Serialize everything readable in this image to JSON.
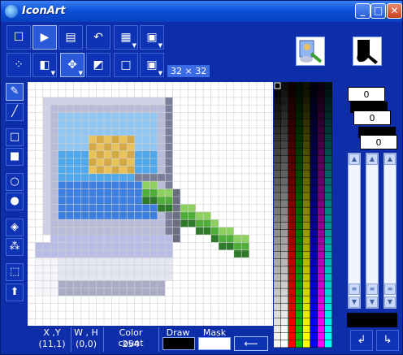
{
  "window": {
    "title": "IconArt",
    "minimize_label": "_",
    "maximize_label": "□",
    "close_label": "✕"
  },
  "toolbar": {
    "row1": [
      {
        "name": "new-file-button",
        "icon": "☐"
      },
      {
        "name": "open-file-button",
        "icon": "▶"
      },
      {
        "name": "save-file-button",
        "icon": "▤"
      },
      {
        "name": "undo-button",
        "icon": "↶"
      },
      {
        "name": "palette-button",
        "icon": "▦",
        "dropdown": true
      },
      {
        "name": "clipboard-button",
        "icon": "▣",
        "dropdown": true
      }
    ],
    "row2": [
      {
        "name": "grid-select-button",
        "icon": "⁘"
      },
      {
        "name": "color-select-button",
        "icon": "◧",
        "dropdown": true
      },
      {
        "name": "move-button",
        "icon": "✥",
        "dropdown": true
      },
      {
        "name": "transparency-button",
        "icon": "◩"
      },
      {
        "name": "frame-button",
        "icon": "□"
      },
      {
        "name": "size-button",
        "icon": "▣",
        "dropdown": true
      }
    ],
    "size_label": "32 × 32"
  },
  "tools": [
    {
      "name": "pencil-tool",
      "icon": "✎",
      "active": true
    },
    {
      "name": "line-tool",
      "icon": "╱"
    },
    {
      "name": "rectangle-tool",
      "icon": "□"
    },
    {
      "name": "filled-rectangle-tool",
      "icon": "■"
    },
    {
      "name": "ellipse-tool",
      "icon": "○"
    },
    {
      "name": "filled-ellipse-tool",
      "icon": "●"
    },
    {
      "name": "fill-tool",
      "icon": "◈"
    },
    {
      "name": "spray-tool",
      "icon": "⁂"
    },
    {
      "name": "select-tool",
      "icon": "⬚"
    },
    {
      "name": "up-arrow-tool",
      "icon": "⬆"
    }
  ],
  "color_values": {
    "r": "0",
    "g": "0",
    "b": "0"
  },
  "status": {
    "xy_label": "X ,Y",
    "xy_value": "(11,1)",
    "wh_label": "W , H",
    "wh_value": "(0,0)",
    "color_count_label": "Color count",
    "color_count_value": "254",
    "draw_label": "Draw",
    "mask_label": "Mask",
    "swap_label": "⟵"
  },
  "bottom_buttons": {
    "left": "↲",
    "right": "↳"
  },
  "colors": {
    "window": "#0d2ea8",
    "palette_columns": [
      "#ff0000",
      "#00c000",
      "#ffff00",
      "#0000ff",
      "#ff00ff",
      "#00ffff"
    ]
  }
}
